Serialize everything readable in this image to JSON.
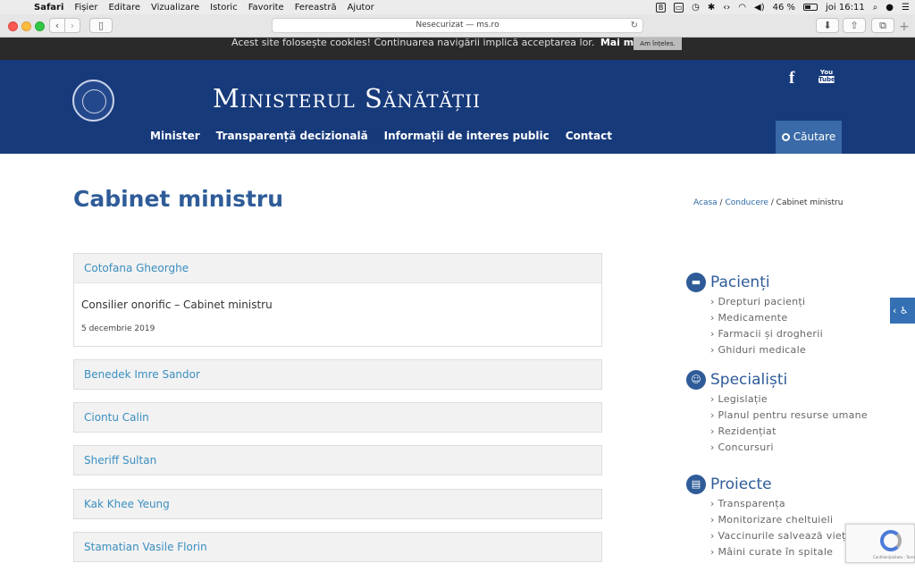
{
  "menubar": {
    "items": [
      "Safari",
      "Fișier",
      "Editare",
      "Vizualizare",
      "Istoric",
      "Favorite",
      "Fereastră",
      "Ajutor"
    ],
    "battery": "46 %",
    "clock": "joi 16:11"
  },
  "browser": {
    "address": "Nesecurizat — ms.ro"
  },
  "cookie": {
    "message": "Acest site folosește cookies! Continuarea navigării implică acceptarea lor.",
    "more": "Mai mult",
    "accept": "Am înțeles."
  },
  "header": {
    "title": "Ministerul Sănătății",
    "nav": [
      "Minister",
      "Transparență decizională",
      "Informații de interes public",
      "Contact"
    ],
    "search": "Căutare",
    "youtube_top": "You",
    "youtube_bottom": "Tube"
  },
  "page": {
    "title": "Cabinet ministru",
    "breadcrumb": [
      "Acasa",
      "Conducere",
      "Cabinet ministru"
    ]
  },
  "accordion": [
    {
      "name": "Cotofana Gheorghe",
      "role": "Consilier onorific – Cabinet ministru",
      "date": "5 decembrie 2019"
    },
    {
      "name": "Benedek Imre Sandor"
    },
    {
      "name": "Ciontu Calin"
    },
    {
      "name": "Sheriff Sultan"
    },
    {
      "name": "Kak Khee Yeung"
    },
    {
      "name": "Stamatian Vasile Florin"
    }
  ],
  "sidebar": [
    {
      "title": "Pacienți",
      "icon": "bed-icon",
      "items": [
        "Drepturi pacienți",
        "Medicamente",
        "Farmacii și drogherii",
        "Ghiduri medicale"
      ]
    },
    {
      "title": "Specialiști",
      "icon": "doctor-icon",
      "items": [
        "Legislație",
        "Planul pentru resurse umane",
        "Rezidențiat",
        "Concursuri"
      ]
    },
    {
      "title": "Proiecte",
      "icon": "clipboard-icon",
      "items": [
        "Transparența",
        "Monitorizare cheltuieli",
        "Vaccinurile salvează vieți",
        "Mâini curate în spitale"
      ]
    }
  ],
  "colors": {
    "header_bg": "#173a7b",
    "accent": "#2f5c98",
    "link": "#3a8fc0"
  }
}
